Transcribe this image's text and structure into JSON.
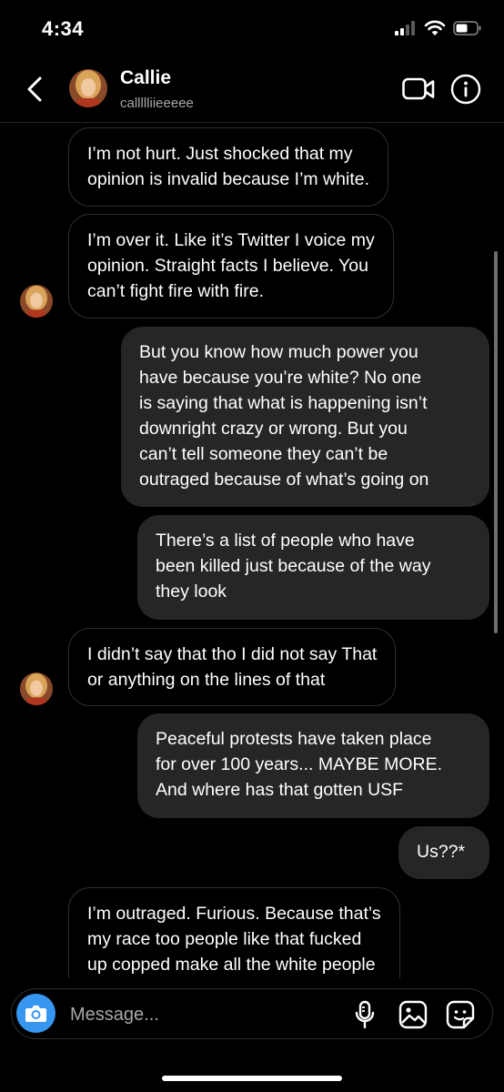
{
  "status_bar": {
    "time": "4:34"
  },
  "header": {
    "contact_name": "Callie",
    "contact_username": "callllliieeeee"
  },
  "messages": [
    {
      "direction": "in",
      "text": "I’m not hurt. Just shocked that my\nopinion is invalid because I’m white."
    },
    {
      "direction": "in",
      "text": "I’m over it. Like it’s Twitter I voice my\nopinion. Straight facts I believe. You\ncan’t fight fire with fire."
    },
    {
      "direction": "out",
      "text": "But you know how much power you\nhave because you’re white? No one\nis saying that what is happening isn’t\ndownright crazy or wrong. But you\ncan’t tell someone they can’t be\noutraged because of what’s going on"
    },
    {
      "direction": "out",
      "text": "There’s a list of people who have\nbeen killed just because of the way\nthey look"
    },
    {
      "direction": "in",
      "text": "I didn’t say that tho I did not say That\nor anything on the lines of that"
    },
    {
      "direction": "out",
      "text": "Peaceful protests have taken place\nfor over 100 years... MAYBE MORE.\nAnd where has that gotten USF"
    },
    {
      "direction": "out",
      "text": "Us??*"
    },
    {
      "direction": "in",
      "text": "I’m outraged. Furious. Because that’s\nmy race too people like that fucked\nup copped make all the white people"
    }
  ],
  "composer": {
    "placeholder": "Message..."
  },
  "colors": {
    "accent": "#3797f0",
    "outgoing_bubble": "#262626",
    "background": "#000000"
  }
}
